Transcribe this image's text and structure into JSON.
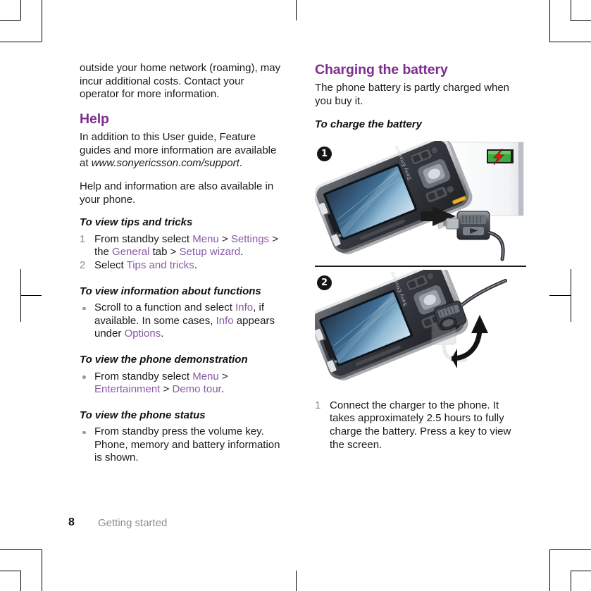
{
  "document": {
    "page_number": "8",
    "running_head": "Getting started"
  },
  "left_column": {
    "continued_paragraph": "outside your home network (roaming), may incur additional costs. Contact your operator for more information.",
    "help": {
      "heading": "Help",
      "paragraph_1_pre": "In addition to this User guide, Feature guides and more information are available at ",
      "paragraph_1_url": "www.sonyericsson.com/support",
      "paragraph_1_post": ".",
      "paragraph_2": "Help and information are also available in your phone."
    },
    "tips_and_tricks": {
      "heading": "To view tips and tricks",
      "steps": [
        {
          "number": "1",
          "parts": [
            {
              "text": "From standby select ",
              "link": false
            },
            {
              "text": "Menu",
              "link": true
            },
            {
              "text": " > ",
              "link": false
            },
            {
              "text": "Settings",
              "link": true
            },
            {
              "text": " > the ",
              "link": false
            },
            {
              "text": "General",
              "link": true
            },
            {
              "text": " tab > ",
              "link": false
            },
            {
              "text": "Setup wizard",
              "link": true
            },
            {
              "text": ".",
              "link": false
            }
          ]
        },
        {
          "number": "2",
          "parts": [
            {
              "text": "Select ",
              "link": false
            },
            {
              "text": "Tips and tricks",
              "link": true
            },
            {
              "text": ".",
              "link": false
            }
          ]
        }
      ]
    },
    "info_about_functions": {
      "heading": "To view information about functions",
      "bullets": [
        {
          "parts": [
            {
              "text": "Scroll to a function and select ",
              "link": false
            },
            {
              "text": "Info",
              "link": true
            },
            {
              "text": ", if available. In some cases, ",
              "link": false
            },
            {
              "text": "Info",
              "link": true
            },
            {
              "text": " appears under ",
              "link": false
            },
            {
              "text": "Options",
              "link": true
            },
            {
              "text": ".",
              "link": false
            }
          ]
        }
      ]
    },
    "phone_demonstration": {
      "heading": "To view the phone demonstration",
      "bullets": [
        {
          "parts": [
            {
              "text": "From standby select ",
              "link": false
            },
            {
              "text": "Menu",
              "link": true
            },
            {
              "text": " > ",
              "link": false
            },
            {
              "text": "Entertainment",
              "link": true
            },
            {
              "text": " > ",
              "link": false
            },
            {
              "text": "Demo tour",
              "link": true
            },
            {
              "text": ".",
              "link": false
            }
          ]
        }
      ]
    },
    "phone_status": {
      "heading": "To view the phone status",
      "bullets": [
        {
          "parts": [
            {
              "text": "From standby press the volume key. Phone, memory and battery information is shown.",
              "link": false
            }
          ]
        }
      ]
    }
  },
  "right_column": {
    "charging": {
      "heading": "Charging the battery",
      "paragraph": "The phone battery is partly charged when you buy it.",
      "procedure_heading": "To charge the battery"
    },
    "figures": [
      {
        "badge": "1",
        "alt": "Sony Ericsson phone with charger plug being inserted into the side connector; a green battery icon with a red lightning bolt is shown on a screen behind the phone",
        "phone_brand": "Sony Ericsson",
        "status_icon": "charging-battery-icon"
      },
      {
        "badge": "2",
        "alt": "Sony Ericsson phone with the charger plug being rotated and pulled out of the connector, indicated by a curved arrow",
        "phone_brand": "Sony Ericsson",
        "status_icon": "rotate-arrow-icon"
      }
    ],
    "steps": [
      {
        "number": "1",
        "text": "Connect the charger to the phone. It takes approximately 2.5 hours to fully charge the battery. Press a key to view the screen."
      }
    ]
  },
  "colors": {
    "heading_purple": "#7d2d8f",
    "link_purple": "#8a5ba6",
    "body_text": "#1a1a1a",
    "muted_gray": "#8c8c8c",
    "battery_green": "#3faa3f",
    "bolt_red": "#e01b24"
  }
}
